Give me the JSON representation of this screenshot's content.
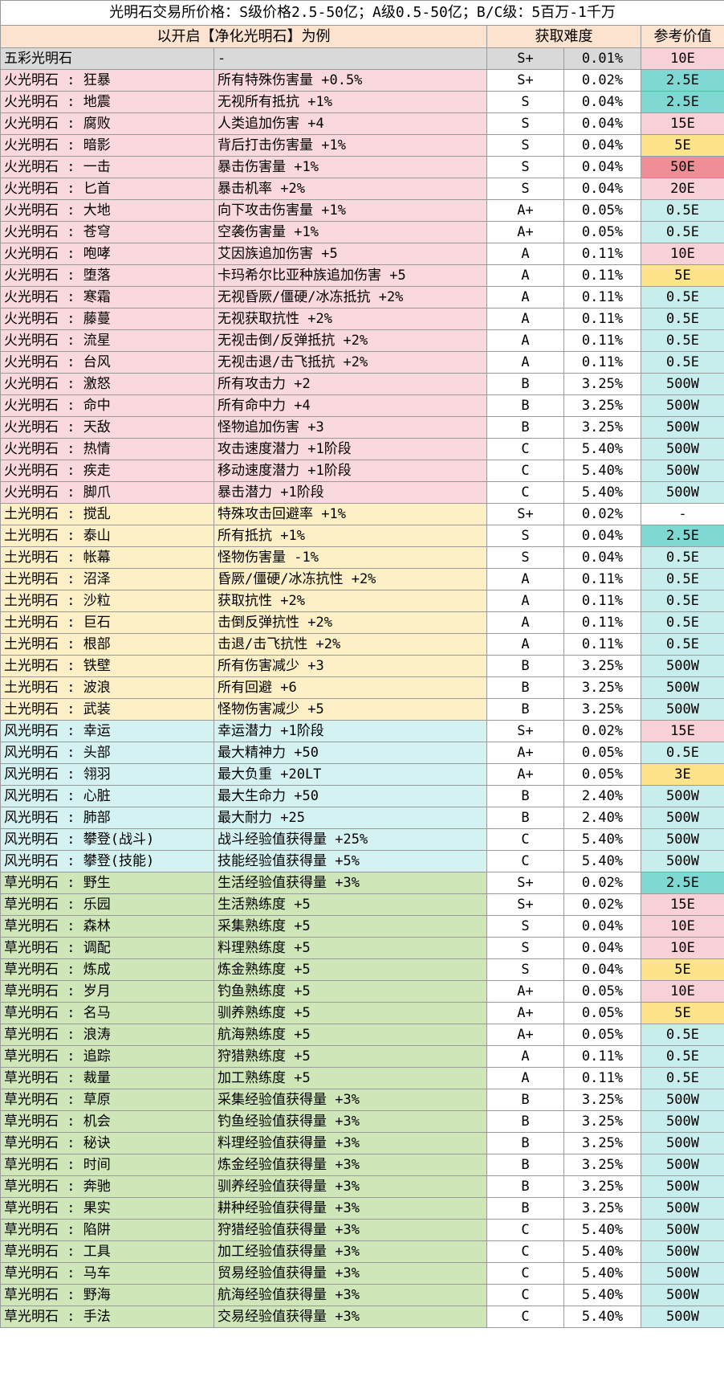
{
  "title": "光明石交易所价格：S级价格2.5-50亿；A级0.5-50亿；B/C级：5百万-1千万",
  "header": {
    "example": "以开启【净化光明石】为例",
    "difficulty": "获取难度",
    "value": "参考价值"
  },
  "colors": {
    "rainbow": "#d9d9d9",
    "fire": "#f9d9dd",
    "earth": "#fdf0c6",
    "wind": "#d5f2f2",
    "grass": "#cfe6b8",
    "header": "#fbe3cf",
    "value_pink": "#f8d0d7",
    "value_teal": "#7fd8d4",
    "value_yellow": "#fde38a",
    "value_red": "#ef8e97",
    "value_lightteal": "#c7eeed"
  },
  "rows": [
    {
      "group": "rainbow",
      "name": "五彩光明石",
      "effect": "-",
      "grade": "S+",
      "rate": "0.01%",
      "value": "10E",
      "vcolor": "pink"
    },
    {
      "group": "fire",
      "name": "火光明石 : 狂暴",
      "effect": "所有特殊伤害量 +0.5%",
      "grade": "S+",
      "rate": "0.02%",
      "value": "2.5E",
      "vcolor": "teal"
    },
    {
      "group": "fire",
      "name": "火光明石 : 地震",
      "effect": "无视所有抵抗 +1%",
      "grade": "S",
      "rate": "0.04%",
      "value": "2.5E",
      "vcolor": "teal"
    },
    {
      "group": "fire",
      "name": "火光明石 : 腐败",
      "effect": "人类追加伤害 +4",
      "grade": "S",
      "rate": "0.04%",
      "value": "15E",
      "vcolor": "pink"
    },
    {
      "group": "fire",
      "name": "火光明石 : 暗影",
      "effect": "背后打击伤害量 +1%",
      "grade": "S",
      "rate": "0.04%",
      "value": "5E",
      "vcolor": "yellow"
    },
    {
      "group": "fire",
      "name": "火光明石 : 一击",
      "effect": "暴击伤害量 +1%",
      "grade": "S",
      "rate": "0.04%",
      "value": "50E",
      "vcolor": "red"
    },
    {
      "group": "fire",
      "name": "火光明石 : 匕首",
      "effect": "暴击机率 +2%",
      "grade": "S",
      "rate": "0.04%",
      "value": "20E",
      "vcolor": "pink"
    },
    {
      "group": "fire",
      "name": "火光明石 : 大地",
      "effect": "向下攻击伤害量 +1%",
      "grade": "A+",
      "rate": "0.05%",
      "value": "0.5E",
      "vcolor": "lightteal"
    },
    {
      "group": "fire",
      "name": "火光明石 : 苍穹",
      "effect": "空袭伤害量 +1%",
      "grade": "A+",
      "rate": "0.05%",
      "value": "0.5E",
      "vcolor": "lightteal"
    },
    {
      "group": "fire",
      "name": "火光明石 : 咆哮",
      "effect": "艾因族追加伤害 +5",
      "grade": "A",
      "rate": "0.11%",
      "value": "10E",
      "vcolor": "pink"
    },
    {
      "group": "fire",
      "name": "火光明石 : 堕落",
      "effect": "卡玛希尔比亚种族追加伤害 +5",
      "grade": "A",
      "rate": "0.11%",
      "value": "5E",
      "vcolor": "yellow"
    },
    {
      "group": "fire",
      "name": "火光明石 : 寒霜",
      "effect": "无视昏厥/僵硬/冰冻抵抗 +2%",
      "grade": "A",
      "rate": "0.11%",
      "value": "0.5E",
      "vcolor": "lightteal"
    },
    {
      "group": "fire",
      "name": "火光明石 : 藤蔓",
      "effect": "无视获取抗性 +2%",
      "grade": "A",
      "rate": "0.11%",
      "value": "0.5E",
      "vcolor": "lightteal"
    },
    {
      "group": "fire",
      "name": "火光明石 : 流星",
      "effect": "无视击倒/反弹抵抗 +2%",
      "grade": "A",
      "rate": "0.11%",
      "value": "0.5E",
      "vcolor": "lightteal"
    },
    {
      "group": "fire",
      "name": "火光明石 : 台风",
      "effect": "无视击退/击飞抵抗 +2%",
      "grade": "A",
      "rate": "0.11%",
      "value": "0.5E",
      "vcolor": "lightteal"
    },
    {
      "group": "fire",
      "name": "火光明石 : 激怒",
      "effect": "所有攻击力 +2",
      "grade": "B",
      "rate": "3.25%",
      "value": "500W",
      "vcolor": "lightteal"
    },
    {
      "group": "fire",
      "name": "火光明石 : 命中",
      "effect": "所有命中力 +4",
      "grade": "B",
      "rate": "3.25%",
      "value": "500W",
      "vcolor": "lightteal"
    },
    {
      "group": "fire",
      "name": "火光明石 : 天敌",
      "effect": "怪物追加伤害 +3",
      "grade": "B",
      "rate": "3.25%",
      "value": "500W",
      "vcolor": "lightteal"
    },
    {
      "group": "fire",
      "name": "火光明石 : 热情",
      "effect": "攻击速度潜力 +1阶段",
      "grade": "C",
      "rate": "5.40%",
      "value": "500W",
      "vcolor": "lightteal"
    },
    {
      "group": "fire",
      "name": "火光明石 : 疾走",
      "effect": "移动速度潜力 +1阶段",
      "grade": "C",
      "rate": "5.40%",
      "value": "500W",
      "vcolor": "lightteal"
    },
    {
      "group": "fire",
      "name": "火光明石 : 脚爪",
      "effect": "暴击潜力 +1阶段",
      "grade": "C",
      "rate": "5.40%",
      "value": "500W",
      "vcolor": "lightteal"
    },
    {
      "group": "earth",
      "name": "土光明石 : 搅乱",
      "effect": "特殊攻击回避率 +1%",
      "grade": "S+",
      "rate": "0.02%",
      "value": "-",
      "vcolor": "white"
    },
    {
      "group": "earth",
      "name": "土光明石 : 泰山",
      "effect": "所有抵抗 +1%",
      "grade": "S",
      "rate": "0.04%",
      "value": "2.5E",
      "vcolor": "teal"
    },
    {
      "group": "earth",
      "name": "土光明石 : 帐幕",
      "effect": "怪物伤害量 -1%",
      "grade": "S",
      "rate": "0.04%",
      "value": "0.5E",
      "vcolor": "lightteal"
    },
    {
      "group": "earth",
      "name": "土光明石 : 沼泽",
      "effect": "昏厥/僵硬/冰冻抗性 +2%",
      "grade": "A",
      "rate": "0.11%",
      "value": "0.5E",
      "vcolor": "lightteal"
    },
    {
      "group": "earth",
      "name": "土光明石 : 沙粒",
      "effect": "获取抗性 +2%",
      "grade": "A",
      "rate": "0.11%",
      "value": "0.5E",
      "vcolor": "lightteal"
    },
    {
      "group": "earth",
      "name": "土光明石 : 巨石",
      "effect": "击倒反弹抗性 +2%",
      "grade": "A",
      "rate": "0.11%",
      "value": "0.5E",
      "vcolor": "lightteal"
    },
    {
      "group": "earth",
      "name": "土光明石 : 根部",
      "effect": "击退/击飞抗性 +2%",
      "grade": "A",
      "rate": "0.11%",
      "value": "0.5E",
      "vcolor": "lightteal"
    },
    {
      "group": "earth",
      "name": "土光明石 : 铁壁",
      "effect": "所有伤害减少 +3",
      "grade": "B",
      "rate": "3.25%",
      "value": "500W",
      "vcolor": "lightteal"
    },
    {
      "group": "earth",
      "name": "土光明石 : 波浪",
      "effect": "所有回避 +6",
      "grade": "B",
      "rate": "3.25%",
      "value": "500W",
      "vcolor": "lightteal"
    },
    {
      "group": "earth",
      "name": "土光明石 : 武装",
      "effect": "怪物伤害减少 +5",
      "grade": "B",
      "rate": "3.25%",
      "value": "500W",
      "vcolor": "lightteal"
    },
    {
      "group": "wind",
      "name": "风光明石 : 幸运",
      "effect": "幸运潜力 +1阶段",
      "grade": "S+",
      "rate": "0.02%",
      "value": "15E",
      "vcolor": "pink"
    },
    {
      "group": "wind",
      "name": "风光明石 : 头部",
      "effect": "最大精神力 +50",
      "grade": "A+",
      "rate": "0.05%",
      "value": "0.5E",
      "vcolor": "lightteal"
    },
    {
      "group": "wind",
      "name": "风光明石 : 翎羽",
      "effect": "最大负重 +20LT",
      "grade": "A+",
      "rate": "0.05%",
      "value": "3E",
      "vcolor": "yellow"
    },
    {
      "group": "wind",
      "name": "风光明石 : 心脏",
      "effect": "最大生命力 +50",
      "grade": "B",
      "rate": "2.40%",
      "value": "500W",
      "vcolor": "lightteal"
    },
    {
      "group": "wind",
      "name": "风光明石 : 肺部",
      "effect": "最大耐力 +25",
      "grade": "B",
      "rate": "2.40%",
      "value": "500W",
      "vcolor": "lightteal"
    },
    {
      "group": "wind",
      "name": "风光明石 : 攀登(战斗)",
      "effect": "战斗经验值获得量 +25%",
      "grade": "C",
      "rate": "5.40%",
      "value": "500W",
      "vcolor": "lightteal"
    },
    {
      "group": "wind",
      "name": "风光明石 : 攀登(技能)",
      "effect": "技能经验值获得量 +5%",
      "grade": "C",
      "rate": "5.40%",
      "value": "500W",
      "vcolor": "lightteal"
    },
    {
      "group": "grass",
      "name": "草光明石 : 野生",
      "effect": "生活经验值获得量 +3%",
      "grade": "S+",
      "rate": "0.02%",
      "value": "2.5E",
      "vcolor": "teal"
    },
    {
      "group": "grass",
      "name": "草光明石 : 乐园",
      "effect": "生活熟练度 +5",
      "grade": "S+",
      "rate": "0.02%",
      "value": "15E",
      "vcolor": "pink"
    },
    {
      "group": "grass",
      "name": "草光明石 : 森林",
      "effect": "采集熟练度 +5",
      "grade": "S",
      "rate": "0.04%",
      "value": "10E",
      "vcolor": "pink"
    },
    {
      "group": "grass",
      "name": "草光明石 : 调配",
      "effect": "料理熟练度 +5",
      "grade": "S",
      "rate": "0.04%",
      "value": "10E",
      "vcolor": "pink"
    },
    {
      "group": "grass",
      "name": "草光明石 : 炼成",
      "effect": "炼金熟练度 +5",
      "grade": "S",
      "rate": "0.04%",
      "value": "5E",
      "vcolor": "yellow"
    },
    {
      "group": "grass",
      "name": "草光明石 : 岁月",
      "effect": "钓鱼熟练度 +5",
      "grade": "A+",
      "rate": "0.05%",
      "value": "10E",
      "vcolor": "pink"
    },
    {
      "group": "grass",
      "name": "草光明石 : 名马",
      "effect": "驯养熟练度 +5",
      "grade": "A+",
      "rate": "0.05%",
      "value": "5E",
      "vcolor": "yellow"
    },
    {
      "group": "grass",
      "name": "草光明石 : 浪涛",
      "effect": "航海熟练度 +5",
      "grade": "A+",
      "rate": "0.05%",
      "value": "0.5E",
      "vcolor": "lightteal"
    },
    {
      "group": "grass",
      "name": "草光明石 : 追踪",
      "effect": "狩猎熟练度 +5",
      "grade": "A",
      "rate": "0.11%",
      "value": "0.5E",
      "vcolor": "lightteal"
    },
    {
      "group": "grass",
      "name": "草光明石 : 裁量",
      "effect": "加工熟练度 +5",
      "grade": "A",
      "rate": "0.11%",
      "value": "0.5E",
      "vcolor": "lightteal"
    },
    {
      "group": "grass",
      "name": "草光明石 : 草原",
      "effect": "采集经验值获得量 +3%",
      "grade": "B",
      "rate": "3.25%",
      "value": "500W",
      "vcolor": "lightteal"
    },
    {
      "group": "grass",
      "name": "草光明石 : 机会",
      "effect": "钓鱼经验值获得量 +3%",
      "grade": "B",
      "rate": "3.25%",
      "value": "500W",
      "vcolor": "lightteal"
    },
    {
      "group": "grass",
      "name": "草光明石 : 秘诀",
      "effect": "料理经验值获得量 +3%",
      "grade": "B",
      "rate": "3.25%",
      "value": "500W",
      "vcolor": "lightteal"
    },
    {
      "group": "grass",
      "name": "草光明石 : 时间",
      "effect": "炼金经验值获得量 +3%",
      "grade": "B",
      "rate": "3.25%",
      "value": "500W",
      "vcolor": "lightteal"
    },
    {
      "group": "grass",
      "name": "草光明石 : 奔驰",
      "effect": "驯养经验值获得量 +3%",
      "grade": "B",
      "rate": "3.25%",
      "value": "500W",
      "vcolor": "lightteal"
    },
    {
      "group": "grass",
      "name": "草光明石 : 果实",
      "effect": "耕种经验值获得量 +3%",
      "grade": "B",
      "rate": "3.25%",
      "value": "500W",
      "vcolor": "lightteal"
    },
    {
      "group": "grass",
      "name": "草光明石 : 陷阱",
      "effect": "狩猎经验值获得量 +3%",
      "grade": "C",
      "rate": "5.40%",
      "value": "500W",
      "vcolor": "lightteal"
    },
    {
      "group": "grass",
      "name": "草光明石 : 工具",
      "effect": "加工经验值获得量 +3%",
      "grade": "C",
      "rate": "5.40%",
      "value": "500W",
      "vcolor": "lightteal"
    },
    {
      "group": "grass",
      "name": "草光明石 : 马车",
      "effect": "贸易经验值获得量 +3%",
      "grade": "C",
      "rate": "5.40%",
      "value": "500W",
      "vcolor": "lightteal"
    },
    {
      "group": "grass",
      "name": "草光明石 : 野海",
      "effect": "航海经验值获得量 +3%",
      "grade": "C",
      "rate": "5.40%",
      "value": "500W",
      "vcolor": "lightteal"
    },
    {
      "group": "grass",
      "name": "草光明石 : 手法",
      "effect": "交易经验值获得量 +3%",
      "grade": "C",
      "rate": "5.40%",
      "value": "500W",
      "vcolor": "lightteal"
    }
  ]
}
